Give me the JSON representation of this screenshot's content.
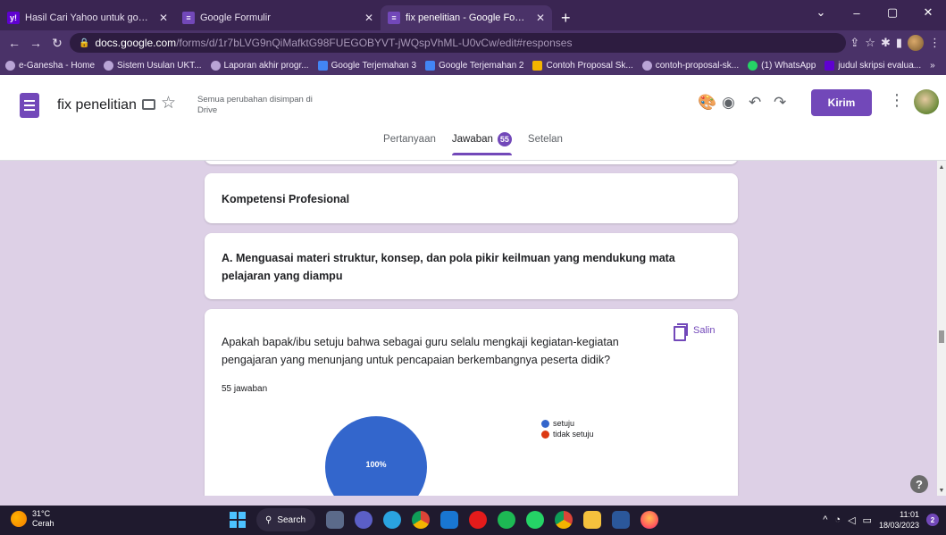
{
  "browser": {
    "tabs": [
      {
        "label": "Hasil Cari Yahoo untuk google fo",
        "icon": "yahoo-icon",
        "active": false
      },
      {
        "label": "Google Formulir",
        "icon": "google-forms-icon",
        "active": false
      },
      {
        "label": "fix penelitian - Google Formulir",
        "icon": "google-forms-icon",
        "active": true
      }
    ],
    "new_tab": "+",
    "url_host": "docs.google.com",
    "url_path": "/forms/d/1r7bLVG9nQiMafktG98FUEGOBYVT-jWQspVhML-U0vCw/edit#responses",
    "bookmarks": [
      "e-Ganesha - Home",
      "Sistem Usulan UKT...",
      "Laporan akhir progr...",
      "Google Terjemahan 3",
      "Google Terjemahan 2",
      "Contoh Proposal Sk...",
      "contoh-proposal-sk...",
      "(1) WhatsApp",
      "judul skripsi evalua...",
      "»"
    ]
  },
  "forms_header": {
    "title": "fix penelitian",
    "save_status": "Semua perubahan disimpan di Drive",
    "send_label": "Kirim",
    "tabs": [
      {
        "label": "Pertanyaan"
      },
      {
        "label": "Jawaban",
        "badge": "55"
      },
      {
        "label": "Setelan"
      }
    ]
  },
  "content": {
    "section_title": "Kompetensi Profesional",
    "subsection_title": "A. Menguasai materi struktur, konsep, dan pola pikir keilmuan yang mendukung mata pelajaran yang diampu",
    "question": "Apakah bapak/ibu setuju bahwa sebagai guru selalu mengkaji kegiatan-kegiatan pengajaran yang menunjang untuk pencapaian berkembangnya peserta didik?",
    "response_count": "55 jawaban",
    "copy_label": "Salin"
  },
  "chart_data": {
    "type": "pie",
    "categories": [
      "setuju",
      "tidak setuju"
    ],
    "values": [
      100,
      0
    ],
    "data_labels": [
      "100%",
      ""
    ],
    "colors": [
      "#3366cc",
      "#dc3912"
    ],
    "legend": "right"
  },
  "taskbar": {
    "temperature": "31°C",
    "weather": "Cerah",
    "search_label": "Search",
    "time": "11:01",
    "date": "18/03/2023",
    "notification_count": "2"
  }
}
